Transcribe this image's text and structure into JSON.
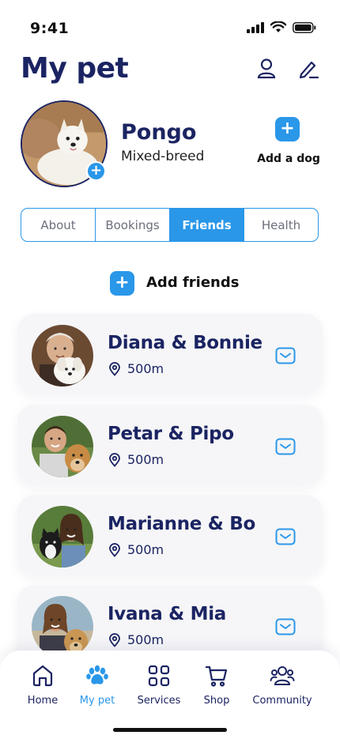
{
  "status": {
    "time": "9:41"
  },
  "header": {
    "title": "My pet"
  },
  "pet": {
    "name": "Pongo",
    "breed": "Mixed-breed",
    "add_photo": "+"
  },
  "add_dog": {
    "icon": "+",
    "label": "Add a dog"
  },
  "tabs": [
    {
      "label": "About",
      "active": false
    },
    {
      "label": "Bookings",
      "active": false
    },
    {
      "label": "Friends",
      "active": true
    },
    {
      "label": "Health",
      "active": false
    }
  ],
  "add_friends": {
    "icon": "+",
    "label": "Add friends"
  },
  "friends": [
    {
      "name": "Diana & Bonnie",
      "distance": "500m"
    },
    {
      "name": "Petar & Pipo",
      "distance": "500m"
    },
    {
      "name": "Marianne & Bo",
      "distance": "500m"
    },
    {
      "name": "Ivana & Mia",
      "distance": "500m"
    }
  ],
  "nav": [
    {
      "label": "Home",
      "icon": "home-icon",
      "active": false
    },
    {
      "label": "My pet",
      "icon": "paw-icon",
      "active": true
    },
    {
      "label": "Services",
      "icon": "grid-icon",
      "active": false
    },
    {
      "label": "Shop",
      "icon": "cart-icon",
      "active": false
    },
    {
      "label": "Community",
      "icon": "community-icon",
      "active": false
    }
  ],
  "colors": {
    "accent": "#2a97e9",
    "navy": "#1b2462",
    "card": "#f6f6f8"
  }
}
